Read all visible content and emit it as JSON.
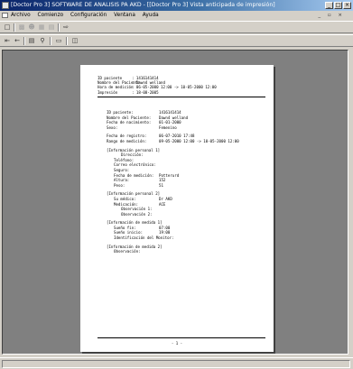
{
  "window": {
    "title": "[Doctor Pro 3] SOFTWARE DE ANALISIS PA AKD - [[Doctor Pro 3] Vista anticipada de impresión]",
    "minimize": "_",
    "maximize": "□",
    "close": "×"
  },
  "menu": {
    "items": [
      "Archivo",
      "Comienzo",
      "Configuración",
      "Ventana",
      "Ayuda"
    ],
    "mdi_controls": "_ ▫ ×"
  },
  "toolbar1": {
    "icons": [
      "doc-icon",
      "save-icon",
      "user-icon",
      "chart-icon",
      "print-icon",
      "exit-icon"
    ]
  },
  "toolbar2": {
    "icons": [
      "first-page-icon",
      "prev-page-icon",
      "print-icon",
      "zoom-icon",
      "single-page-icon",
      "two-page-icon"
    ]
  },
  "report": {
    "header": [
      {
        "label": "ID paciente",
        "value": ": 1416141414"
      },
      {
        "label": "Nombre del Paciente",
        "value": ": Dawn4 welland"
      },
      {
        "label": "Hora de medición",
        "value": ": 06-05-2000 12:00 -> 10-05-2000 12:00"
      },
      {
        "label": "Impresión",
        "value": ": 18-08-2005"
      }
    ],
    "patient": [
      {
        "label": "ID paciente:",
        "value": "1416141414"
      },
      {
        "label": "Nombre del Paciente:",
        "value": "Dawn4 welland"
      },
      {
        "label": "Fecha de nacimiento:",
        "value": "01-01-2000"
      },
      {
        "label": "Sexo:",
        "value": "Femenino"
      }
    ],
    "record": [
      {
        "label": "Fecha de registro:",
        "value": "06-07-2010 17:48"
      },
      {
        "label": "Rango de medición:",
        "value": "09-05-2000 12:00 -> 10-05-2000 12:00"
      }
    ],
    "section1": {
      "title": "[Información personal 1]",
      "rows": [
        {
          "label": "Dirección:",
          "value": ""
        },
        {
          "label": "Teléfono:",
          "value": ""
        },
        {
          "label": "Correo electrónico:",
          "value": ""
        },
        {
          "label": "Seguro:",
          "value": ""
        },
        {
          "label": "Fecha de medición:",
          "value": "Potterurd"
        },
        {
          "label": "Altura:",
          "value": "152"
        },
        {
          "label": "Peso:",
          "value": "51"
        }
      ]
    },
    "section2": {
      "title": "[Información personal 2]",
      "rows": [
        {
          "label": "Su médico:",
          "value": "Dr AKD"
        },
        {
          "label": "Medicación:",
          "value": "ACE"
        },
        {
          "label": "Observación 1:",
          "value": ""
        },
        {
          "label": "Observación 2:",
          "value": ""
        }
      ]
    },
    "section3": {
      "title": "[Información de medida 1]",
      "rows": [
        {
          "label": "Sueño fin:",
          "value": "07:00"
        },
        {
          "label": "Sueño inicio:",
          "value": "19:00"
        },
        {
          "label": "Identificación del Monitor:",
          "value": ""
        }
      ]
    },
    "section4": {
      "title": "[Información de medida 2]",
      "rows": [
        {
          "label": "Observación:",
          "value": ""
        }
      ]
    },
    "page_number": "- 1 -"
  }
}
